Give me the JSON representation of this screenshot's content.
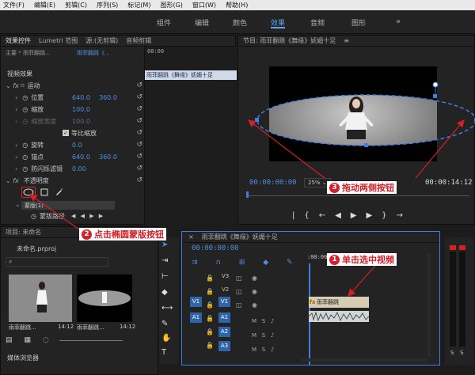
{
  "menu": [
    "文件(F)",
    "编辑(E)",
    "剪辑(C)",
    "序列(S)",
    "标记(M)",
    "图形(G)",
    "窗口(W)",
    "帮助(H)"
  ],
  "workspaces": [
    "组件",
    "编辑",
    "颜色",
    "效果",
    "音频",
    "图形"
  ],
  "active_workspace": "效果",
  "effect_controls": {
    "tabs": [
      "效果控件",
      "Lumetri 范围",
      "源:(无剪辑)",
      "音频剪辑"
    ],
    "master": "主要 * 雨菲翻跳...",
    "clip": "雨菲翻跳《...",
    "timecode": "00:00",
    "clip_bar": "雨菲翻跳《舞缘》妩媚十足",
    "section": "视频效果",
    "motion": "运动",
    "props": [
      {
        "name": "位置",
        "v1": "640.0",
        "v2": "360.0"
      },
      {
        "name": "缩放",
        "v1": "100.0",
        "v2": ""
      },
      {
        "name": "缩放宽度",
        "v1": "100.0",
        "v2": ""
      },
      {
        "name": "等比缩放",
        "v1": "",
        "v2": ""
      },
      {
        "name": "旋转",
        "v1": "0.0",
        "v2": ""
      },
      {
        "name": "锚点",
        "v1": "640.0",
        "v2": "360.0"
      },
      {
        "name": "防闪烁滤镜",
        "v1": "0.00",
        "v2": ""
      }
    ],
    "opacity": "不透明度",
    "mask": "蒙版(1)",
    "mask_path": "蒙版路径"
  },
  "program_monitor": {
    "title": "节目: 雨菲翻跳《舞缘》妩媚十足",
    "timecode": "00:00:00:00",
    "zoom": "25%",
    "duration": "00:00:14:12"
  },
  "project": {
    "title": "项目: 未命名",
    "file": "未命名.prproj",
    "thumb1_name": "雨菲翻跳...",
    "thumb1_dur": "14:12",
    "thumb2_name": "雨菲翻跳...",
    "thumb2_dur": "14:12",
    "media_browser": "媒体浏览器"
  },
  "timeline": {
    "title": "雨菲翻跳《舞缘》妩媚十足",
    "timecode": "00:00:00:00",
    "ruler": ":00:00",
    "tracks": [
      "V3",
      "V2",
      "V1",
      "A1",
      "A2",
      "A3"
    ],
    "clip_label": "雨菲翻跳",
    "meter_labels": [
      "S",
      "S"
    ]
  },
  "callouts": {
    "c1": {
      "num": "1",
      "text": "单击选中视频"
    },
    "c2": {
      "num": "2",
      "text": "点击椭圆蒙版按钮"
    },
    "c3": {
      "num": "3",
      "text": "拖动两侧按钮"
    }
  },
  "colors": {
    "accent": "#4f8fe0",
    "callout": "#d3202a"
  }
}
